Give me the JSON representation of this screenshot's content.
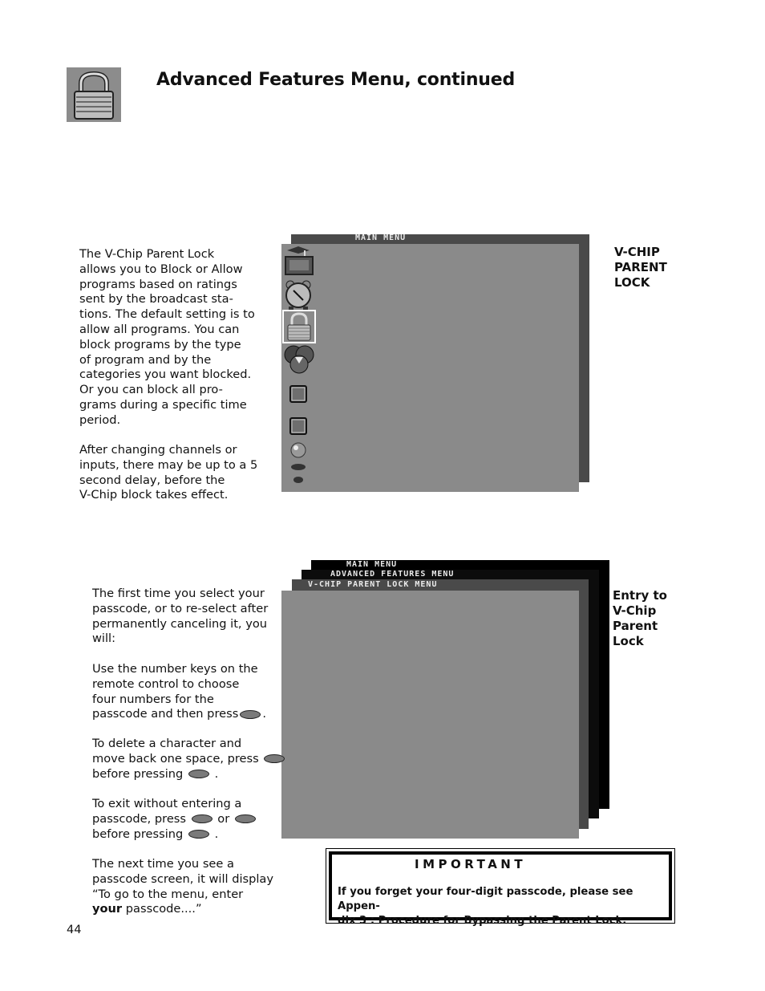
{
  "header": {
    "icon": "padlock-icon",
    "title": "Advanced Features Menu, continued"
  },
  "section1": {
    "paragraphs": [
      "The V-Chip Parent Lock\nallows you to Block or  Allow\nprograms based on ratings\nsent by the broadcast sta-\ntions.  The default setting is to\nallow all programs.   You can\nblock programs by the type\nof program and by the\ncategories you want blocked.\nOr you can block all pro-\ngrams during a specific time\nperiod.",
      "After changing channels or\ninputs, there may be up to a 5\nsecond delay,  before the\nV-Chip block takes effect."
    ],
    "side_label": "V-CHIP\nPARENT\nLOCK",
    "screen": {
      "title": "MAIN MENU",
      "icons": [
        {
          "name": "tv-graduation-cap-icon"
        },
        {
          "name": "alarm-clock-icon"
        },
        {
          "name": "padlock-icon",
          "selected": true
        },
        {
          "name": "color-circles-icon"
        },
        {
          "name": "square-button-icon"
        },
        {
          "name": "square-button-icon"
        },
        {
          "name": "sphere-icon"
        },
        {
          "name": "oval-button-icon"
        },
        {
          "name": "small-oval-button-icon"
        }
      ]
    }
  },
  "section2": {
    "p1": "The first time you select your\npasscode, or to re-select after\npermanently canceling it,  you\nwill:",
    "p2_lines": [
      "Use the number keys on the",
      "remote control to choose",
      "four numbers for the",
      "passcode and then press"
    ],
    "p3_lines": [
      "To delete a character and",
      "move back one space, press",
      "before pressing"
    ],
    "p4_lines": [
      "To exit without entering a",
      "passcode, press",
      "or",
      "before pressing"
    ],
    "p5_lines": [
      "The next time you see a",
      "passcode screen, it will display",
      "“To go to the menu, enter"
    ],
    "p5_bold": "your",
    "p5_end": " passcode....”",
    "period": ".",
    "side_label": "Entry to\nV-Chip\nParent\nLock",
    "screens": {
      "main": "MAIN MENU",
      "advanced": "ADVANCED FEATURES MENU",
      "vchip": "V-CHIP PARENT LOCK MENU"
    }
  },
  "important": {
    "title": "IMPORTANT",
    "body": "If you forget your four-digit passcode, please see Appen-\ndix 3 : Procedure for Bypassing the Parent Lock."
  },
  "page_number": "44"
}
